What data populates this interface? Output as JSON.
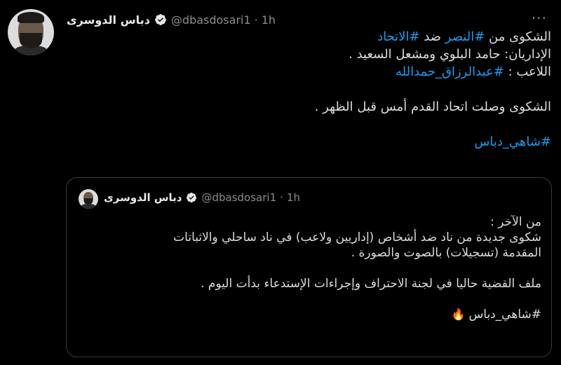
{
  "tweet": {
    "author_name": "دباس الدوسرى",
    "handle": "@dbasdosari1",
    "separator": "·",
    "time": "1h",
    "more_label": "···",
    "lines": [
      {
        "parts": [
          {
            "text": "الشكوى من "
          },
          {
            "text": "#النصر",
            "hashtag": true
          },
          {
            "text": " ضد "
          },
          {
            "text": "#الاتحاد",
            "hashtag": true
          }
        ]
      },
      {
        "parts": [
          {
            "text": "الإداريان: حامد البلوي ومشعل السعيد ."
          }
        ]
      },
      {
        "parts": [
          {
            "text": "اللاعب : "
          },
          {
            "text": "#عبدالرزاق_حمدالله",
            "hashtag": true
          }
        ]
      },
      {
        "parts": [
          {
            "text": ""
          }
        ]
      },
      {
        "parts": [
          {
            "text": "الشكوى وصلت اتحاد القدم أمس قبل الظهر ."
          }
        ]
      },
      {
        "parts": [
          {
            "text": ""
          }
        ]
      },
      {
        "parts": [
          {
            "text": "#شاهي_دباس",
            "hashtag": true
          }
        ]
      }
    ]
  },
  "quote": {
    "author_name": "دباس الدوسرى",
    "handle": "@dbasdosari1",
    "separator": "·",
    "time": "1h",
    "lines": [
      "من الآخر :",
      "شكوى جديدة من ناد ضد أشخاص (إداريين ولاعب) في ناد ساحلي والاثباتات",
      "المقدمة (تسجيلات) بالصوت والصورة .",
      "",
      "ملف القضية حاليا في لجنة الاحتراف وإجراءات الإستدعاء بدأت اليوم .",
      "",
      "#شاهي_دباس"
    ],
    "emoji": "🔥"
  },
  "colors": {
    "background": "#000000",
    "text": "#d9d9d9",
    "hashtag": "#1d9bf0",
    "muted": "#8a8d91",
    "border": "#3b3b3b"
  },
  "icons": {
    "verified": "verified-badge-icon",
    "more": "more-options-icon",
    "fire": "fire-emoji-icon"
  }
}
